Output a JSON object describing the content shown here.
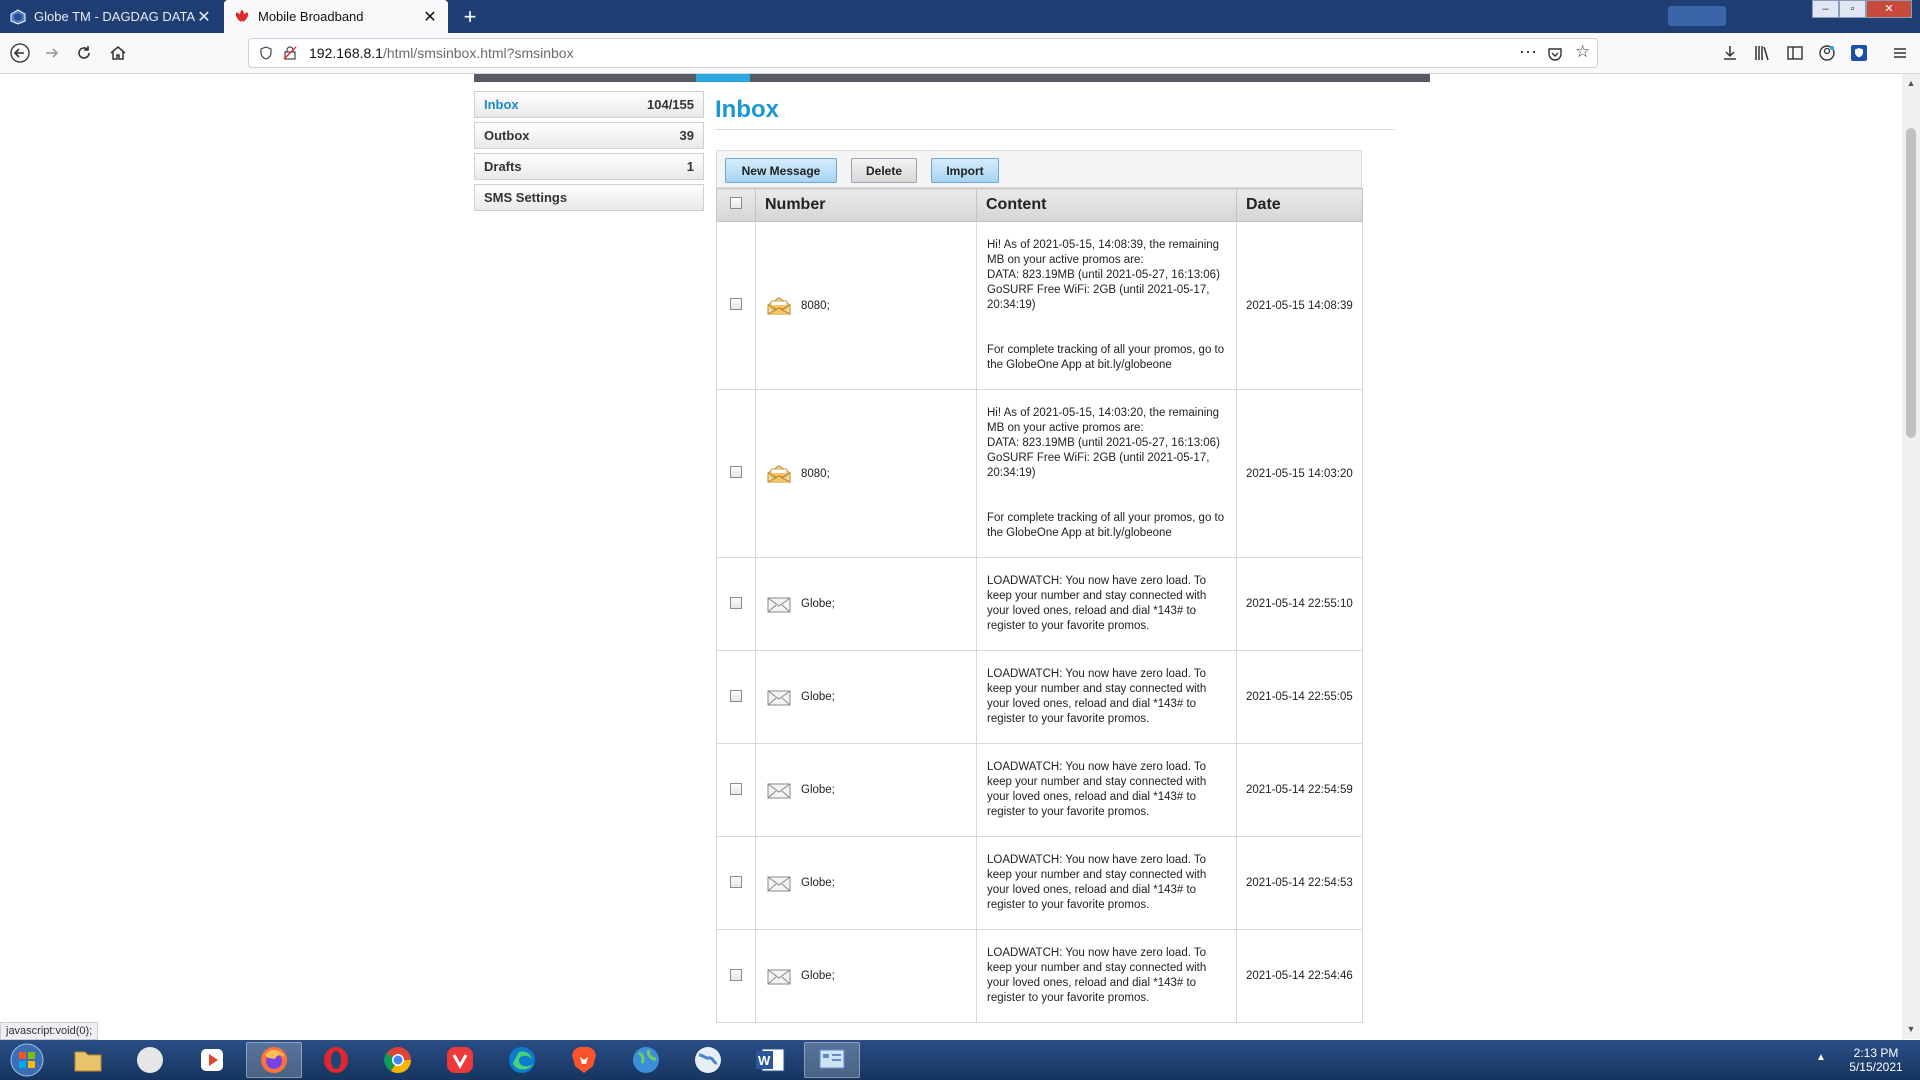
{
  "browser": {
    "tabs": [
      {
        "label": "Globe TM - DAGDAG DATA UL",
        "active": false
      },
      {
        "label": "Mobile Broadband",
        "active": true
      }
    ],
    "url_host": "192.168.8.1",
    "url_path": "/html/smsinbox.html?smsinbox",
    "status_text": "javascript:void(0);"
  },
  "sidebar": {
    "items": [
      {
        "label": "Inbox",
        "count": "104/155",
        "active": true
      },
      {
        "label": "Outbox",
        "count": "39"
      },
      {
        "label": "Drafts",
        "count": "1"
      },
      {
        "label": "SMS Settings",
        "count": ""
      }
    ]
  },
  "main": {
    "title": "Inbox",
    "toolbar": {
      "new_message": "New Message",
      "delete": "Delete",
      "import": "Import"
    },
    "columns": {
      "number": "Number",
      "content": "Content",
      "date": "Date"
    },
    "messages": [
      {
        "number": "8080;",
        "read": false,
        "date": "2021-05-15 14:08:39",
        "content": "Hi! As of 2021-05-15, 14:08:39, the remaining MB on your active promos are:\nDATA: 823.19MB (until 2021-05-27, 16:13:06)\nGoSURF Free WiFi: 2GB (until 2021-05-17, 20:34:19)\n\n\nFor complete tracking of all your promos, go to the GlobeOne App at bit.ly/globeone"
      },
      {
        "number": "8080;",
        "read": false,
        "date": "2021-05-15 14:03:20",
        "content": "Hi! As of 2021-05-15, 14:03:20, the remaining MB on your active promos are:\nDATA: 823.19MB (until 2021-05-27, 16:13:06)\nGoSURF Free WiFi: 2GB (until 2021-05-17, 20:34:19)\n\n\nFor complete tracking of all your promos, go to the GlobeOne App at bit.ly/globeone"
      },
      {
        "number": "Globe;",
        "read": true,
        "date": "2021-05-14 22:55:10",
        "content": "LOADWATCH: You now have zero load. To keep your number and stay connected with your loved ones, reload and dial *143# to register to your favorite promos."
      },
      {
        "number": "Globe;",
        "read": true,
        "date": "2021-05-14 22:55:05",
        "content": "LOADWATCH: You now have zero load. To keep your number and stay connected with your loved ones, reload and dial *143# to register to your favorite promos."
      },
      {
        "number": "Globe;",
        "read": true,
        "date": "2021-05-14 22:54:59",
        "content": "LOADWATCH: You now have zero load. To keep your number and stay connected with your loved ones, reload and dial *143# to register to your favorite promos."
      },
      {
        "number": "Globe;",
        "read": true,
        "date": "2021-05-14 22:54:53",
        "content": "LOADWATCH: You now have zero load. To keep your number and stay connected with your loved ones, reload and dial *143# to register to your favorite promos."
      },
      {
        "number": "Globe;",
        "read": true,
        "date": "2021-05-14 22:54:46",
        "content": "LOADWATCH: You now have zero load. To keep your number and stay connected with your loved ones, reload and dial *143# to register to your favorite promos."
      }
    ]
  },
  "taskbar": {
    "clock_time": "2:13 PM",
    "clock_date": "5/15/2021"
  },
  "colors": {
    "accent": "#1a98d4",
    "tabstrip": "#1f3e73",
    "taskbar": "#1f4478"
  }
}
